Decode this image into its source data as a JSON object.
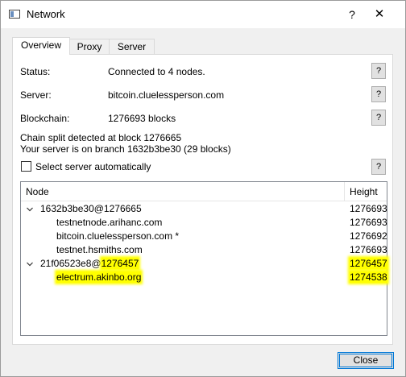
{
  "window": {
    "title": "Network",
    "help_glyph": "?",
    "close_glyph": "✕"
  },
  "tabs": [
    {
      "label": "Overview",
      "active": true
    },
    {
      "label": "Proxy",
      "active": false
    },
    {
      "label": "Server",
      "active": false
    }
  ],
  "overview": {
    "status_label": "Status:",
    "status_value": "Connected to 4 nodes.",
    "server_label": "Server:",
    "server_value": "bitcoin.cluelessperson.com",
    "blockchain_label": "Blockchain:",
    "blockchain_value": "1276693 blocks",
    "split_line1": "Chain split detected at block 1276665",
    "split_line2": "Your server is on branch 1632b3be30 (29 blocks)",
    "help_button": "?",
    "auto_select_label": "Select server automatically",
    "auto_select_checked": false
  },
  "tree": {
    "col_node": "Node",
    "col_height": "Height",
    "rows": [
      {
        "indent": 0,
        "expanded": true,
        "node": "1632b3be30@1276665",
        "height": "1276693"
      },
      {
        "indent": 1,
        "node": "testnetnode.arihanc.com",
        "height": "1276693"
      },
      {
        "indent": 1,
        "node": "bitcoin.cluelessperson.com *",
        "height": "1276692"
      },
      {
        "indent": 1,
        "node": "testnet.hsmiths.com",
        "height": "1276693"
      },
      {
        "indent": 0,
        "expanded": true,
        "node_prefix": "21f06523e8@",
        "node_highlight": "1276457",
        "height": "1276457",
        "highlighted": true
      },
      {
        "indent": 1,
        "node": "electrum.akinbo.org",
        "height": "1274538",
        "highlighted": true
      }
    ]
  },
  "footer": {
    "close_label": "Close"
  },
  "colors": {
    "highlight": "#ffff00",
    "focus_border": "#0078d7"
  }
}
